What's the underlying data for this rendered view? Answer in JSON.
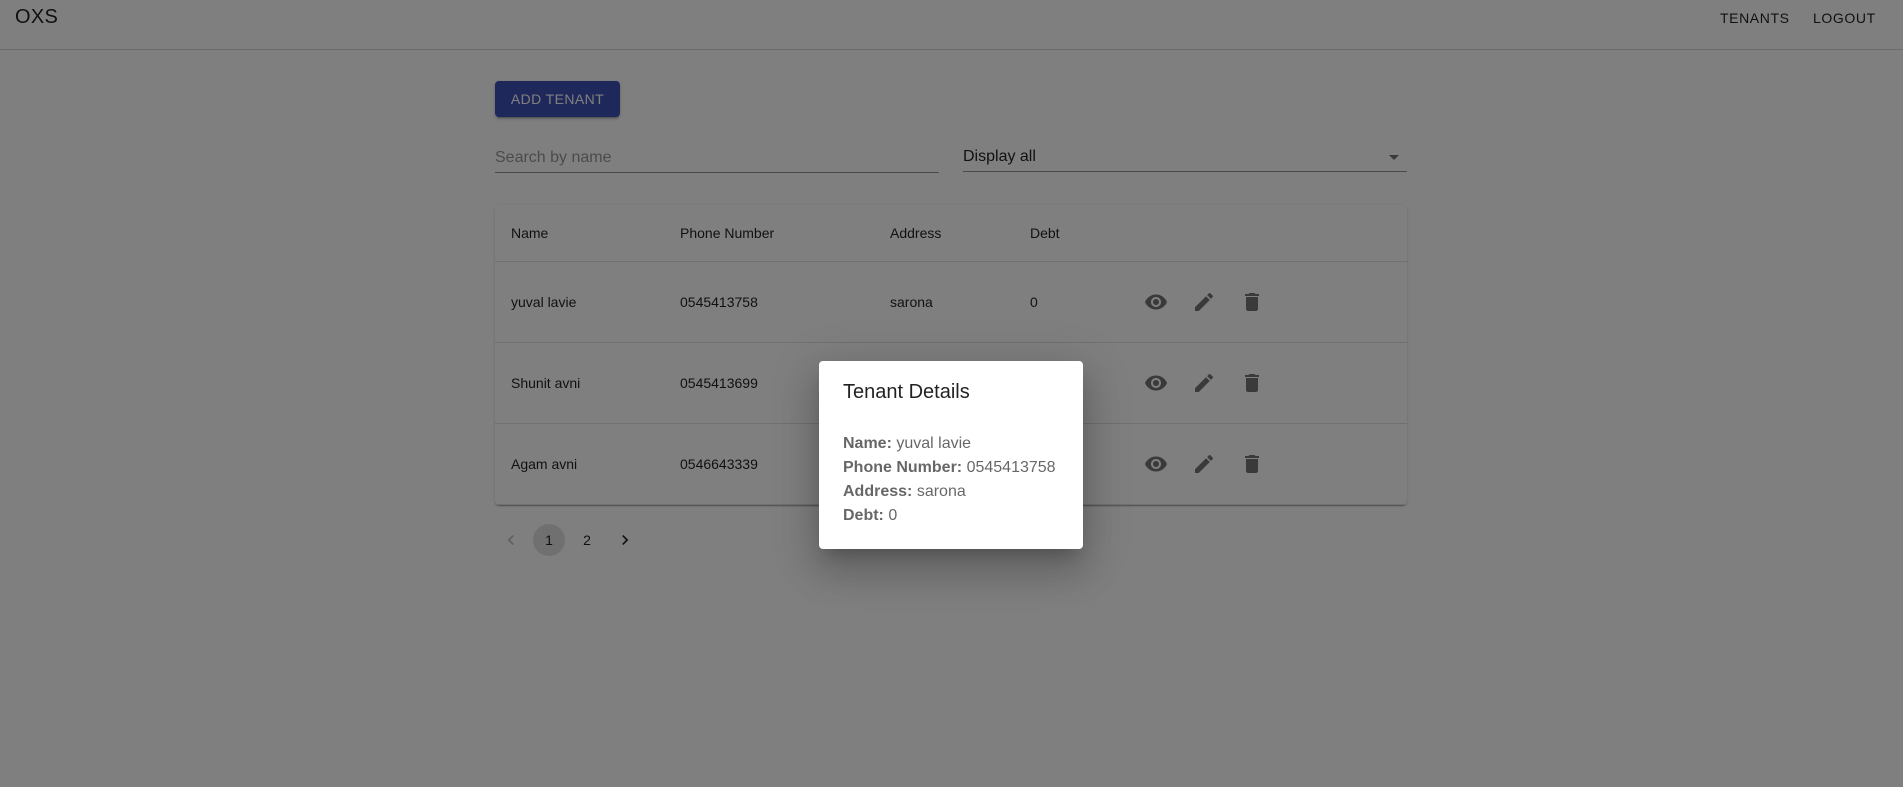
{
  "header": {
    "brand": "OXS",
    "nav": {
      "tenants": "TENANTS",
      "logout": "LOGOUT"
    }
  },
  "toolbar": {
    "add_label": "ADD TENANT",
    "search_placeholder": "Search by name",
    "search_value": "",
    "filter_value": "Display all"
  },
  "table": {
    "headers": {
      "name": "Name",
      "phone": "Phone Number",
      "address": "Address",
      "debt": "Debt"
    },
    "rows": [
      {
        "name": "yuval lavie",
        "phone": "0545413758",
        "address": "sarona",
        "debt": "0"
      },
      {
        "name": "Shunit avni",
        "phone": "0545413699",
        "address": "",
        "debt": ""
      },
      {
        "name": "Agam avni",
        "phone": "0546643339",
        "address": "",
        "debt": ""
      }
    ],
    "row_icons": [
      "eye-icon",
      "pencil-icon",
      "trash-icon"
    ]
  },
  "pagination": {
    "pages": [
      "1",
      "2"
    ],
    "current": "1"
  },
  "dialog": {
    "title": "Tenant Details",
    "name_label": "Name:",
    "name_value": "yuval lavie",
    "phone_label": "Phone Number:",
    "phone_value": "0545413758",
    "address_label": "Address:",
    "address_value": "sarona",
    "debt_label": "Debt:",
    "debt_value": "0"
  },
  "colors": {
    "primary": "#3f51b5",
    "backdrop": "rgba(0,0,0,0.5)"
  }
}
